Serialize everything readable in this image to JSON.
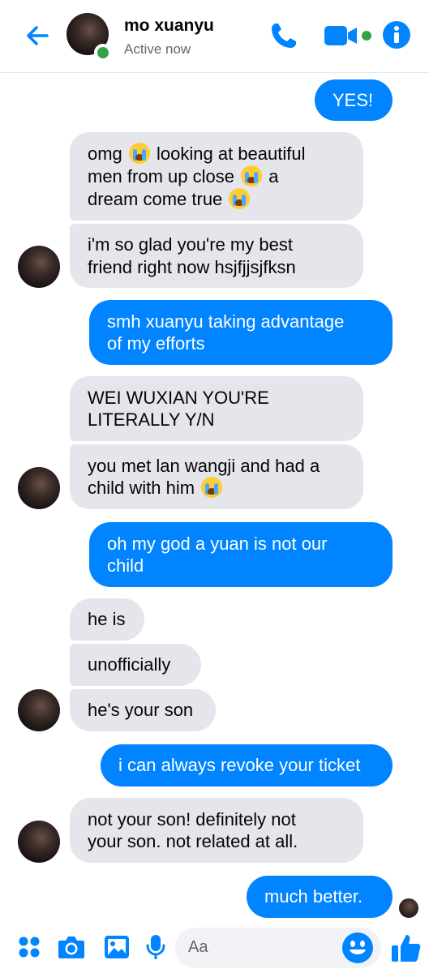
{
  "header": {
    "contact_name": "mo xuanyu",
    "status": "Active now",
    "accent_color": "#0084ff",
    "online_color": "#31a24c",
    "icons": [
      "back-arrow-icon",
      "phone-icon",
      "video-camera-icon",
      "info-icon"
    ]
  },
  "messages": [
    {
      "sender": "me",
      "text": "YES!"
    },
    {
      "sender": "contact",
      "parts": [
        "omg ",
        " looking at beautiful",
        "men from up close ",
        " a",
        "dream come true "
      ]
    },
    {
      "sender": "contact",
      "lines": [
        "i'm so glad you're my best",
        "friend right now hsjfjjsjfksn"
      ]
    },
    {
      "sender": "me",
      "lines": [
        "smh xuanyu taking advantage",
        "of my efforts"
      ]
    },
    {
      "sender": "contact",
      "lines": [
        "WEI WUXIAN YOU'RE",
        "LITERALLY Y/N"
      ]
    },
    {
      "sender": "contact",
      "lines": [
        "you met lan wangji and had a",
        "child with him "
      ]
    },
    {
      "sender": "me",
      "lines": [
        "oh my god a yuan is not our",
        "child"
      ]
    },
    {
      "sender": "contact",
      "text": "he is"
    },
    {
      "sender": "contact",
      "text": "unofficially"
    },
    {
      "sender": "contact",
      "text": "he's your son"
    },
    {
      "sender": "me",
      "text": "i can always revoke your ticket"
    },
    {
      "sender": "contact",
      "lines": [
        "not your son! definitely not",
        "your son. not related at all."
      ]
    },
    {
      "sender": "me",
      "text": "much better."
    }
  ],
  "composer": {
    "placeholder": "Aa",
    "icons": [
      "apps-icon",
      "camera-icon",
      "gallery-icon",
      "microphone-icon",
      "emoji-icon",
      "thumbs-up-icon"
    ]
  },
  "colors": {
    "outgoing_bubble": "#0084ff",
    "incoming_bubble": "#e4e6eb"
  }
}
